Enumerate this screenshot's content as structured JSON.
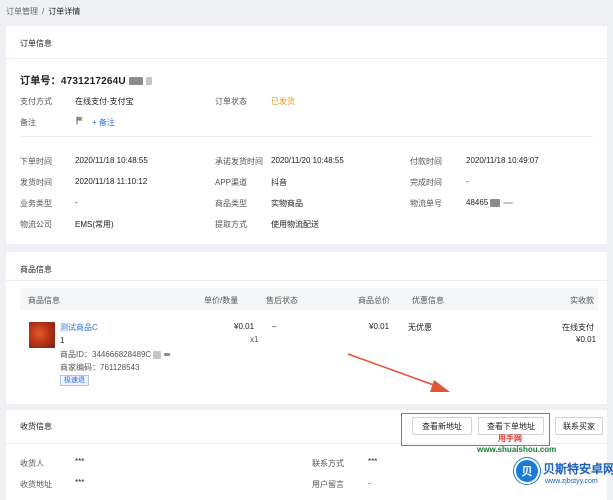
{
  "breadcrumb": {
    "parent": "订单管理",
    "separator": "/",
    "current": "订单详情"
  },
  "order_card": {
    "title": "订单信息",
    "order_no_label": "订单号：",
    "order_no": "4731217264U",
    "payment_method_label": "支付方式",
    "payment_method": "在线支付-支付宝",
    "order_status_label": "订单状态",
    "order_status": "已发货",
    "remark_label": "备注",
    "add_remark": "+ 备注",
    "fields": {
      "order_time_label": "下单时间",
      "order_time": "2020/11/18 10:48:55",
      "promise_ship_label": "承诺发货时间",
      "promise_ship": "2020/11/20 10:48:55",
      "pay_time_label": "付款时间",
      "pay_time": "2020/11/18 10:49:07",
      "ship_time_label": "发货时间",
      "ship_time": "2020/11/18 11:10:12",
      "app_channel_label": "APP渠道",
      "app_channel": "抖音",
      "finish_time_label": "完成时间",
      "finish_time": "-",
      "biz_type_label": "业务类型",
      "biz_type": "-",
      "goods_type_label": "商品类型",
      "goods_type": "实物商品",
      "tracking_no_label": "物流单号",
      "tracking_no": "48465",
      "logistics_label": "物流公司",
      "logistics": "EMS(常用)",
      "pickup_label": "提取方式",
      "pickup": "使用物流配送"
    }
  },
  "product_card": {
    "title": "商品信息",
    "columns": [
      "商品信息",
      "单价/数量",
      "售后状态",
      "商品总价",
      "优惠信息",
      "实收款"
    ],
    "item": {
      "name": "测试商品C",
      "qty_line": "1",
      "product_id": "商品ID：344666828489C",
      "merchant_code": "商家编码：761128543",
      "tag": "极速退",
      "unit_price": "¥0.01",
      "quantity": "x1",
      "after_sale": "–",
      "total": "¥0.01",
      "discount": "无优惠",
      "paid_method": "在线支付",
      "paid_amount": "¥0.01"
    }
  },
  "receive_card": {
    "title": "收货信息",
    "btn_view_new": "查看新地址",
    "btn_view_order": "查看下单地址",
    "btn_contact": "联系买家",
    "receiver_label": "收货人",
    "receiver": "***",
    "contact_label": "联系方式",
    "contact": "***",
    "address_label": "收货地址",
    "address": "***",
    "message_label": "用户留言",
    "message": "-"
  },
  "watermark": {
    "text": "用手网",
    "url": "www.shuaishou.com",
    "logo_char": "贝",
    "logo_title": "贝斯特安卓网",
    "logo_url": "www.zjbstyy.com"
  },
  "colors": {
    "link": "#2d6fdf",
    "status_orange": "#e59b2b",
    "annotation_red": "#e05535"
  }
}
